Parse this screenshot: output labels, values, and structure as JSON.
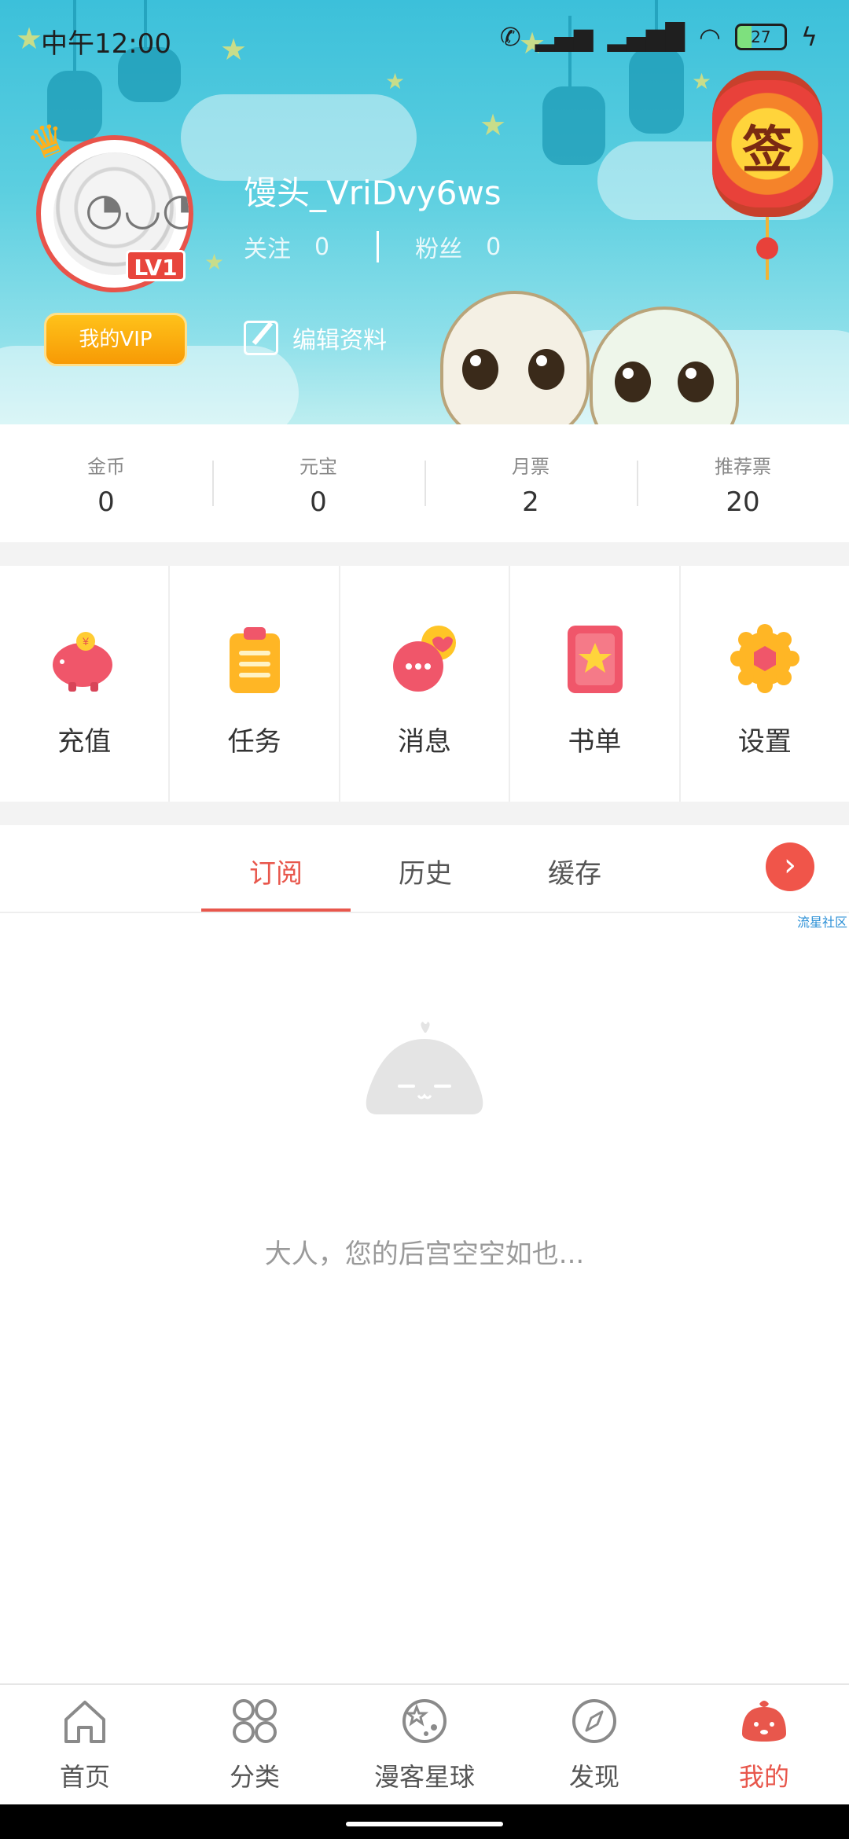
{
  "status_bar": {
    "time": "中午12:00",
    "battery": "27"
  },
  "profile": {
    "username": "馒头_VriDvy6ws",
    "level_badge": "LV1",
    "follow_label": "关注",
    "follow_count": "0",
    "fans_label": "粉丝",
    "fans_count": "0",
    "vip_label": "我的VIP",
    "edit_label": "编辑资料",
    "signin_char": "签"
  },
  "stats": [
    {
      "label": "金币",
      "value": "0"
    },
    {
      "label": "元宝",
      "value": "0"
    },
    {
      "label": "月票",
      "value": "2"
    },
    {
      "label": "推荐票",
      "value": "20"
    }
  ],
  "features": [
    {
      "label": "充值",
      "icon": "piggy-bank-icon"
    },
    {
      "label": "任务",
      "icon": "clipboard-icon"
    },
    {
      "label": "消息",
      "icon": "message-bubble-icon"
    },
    {
      "label": "书单",
      "icon": "booklist-icon"
    },
    {
      "label": "设置",
      "icon": "gear-icon"
    }
  ],
  "tabs": {
    "items": [
      {
        "label": "订阅",
        "active": true
      },
      {
        "label": "历史",
        "active": false
      },
      {
        "label": "缓存",
        "active": false
      }
    ],
    "community_link": "流星社区"
  },
  "empty_state": {
    "message": "大人，您的后宫空空如也..."
  },
  "nav": [
    {
      "label": "首页",
      "icon": "home-icon",
      "active": false
    },
    {
      "label": "分类",
      "icon": "category-grid-icon",
      "active": false
    },
    {
      "label": "漫客星球",
      "icon": "planet-icon",
      "active": false
    },
    {
      "label": "发现",
      "icon": "compass-icon",
      "active": false
    },
    {
      "label": "我的",
      "icon": "mine-bun-icon",
      "active": true
    }
  ],
  "colors": {
    "accent": "#e8574c",
    "header_top": "#3cc0da",
    "vip": "#f79a05"
  }
}
